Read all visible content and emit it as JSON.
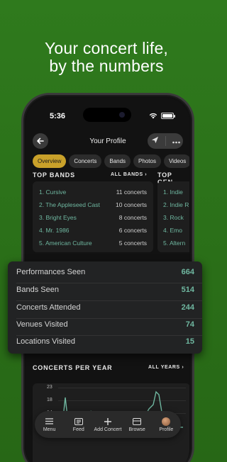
{
  "headline": {
    "line1": "Your concert life,",
    "line2": "by the numbers"
  },
  "status": {
    "time": "5:36"
  },
  "nav": {
    "title": "Your Profile"
  },
  "tabs": [
    "Overview",
    "Concerts",
    "Bands",
    "Photos",
    "Videos"
  ],
  "top_bands": {
    "title": "TOP BANDS",
    "link": "ALL BANDS",
    "items": [
      {
        "name": "1. Cursive",
        "count": "11 concerts"
      },
      {
        "name": "2. The Appleseed Cast",
        "count": "10 concerts"
      },
      {
        "name": "3. Bright Eyes",
        "count": "8 concerts"
      },
      {
        "name": "4. Mr. 1986",
        "count": "6 concerts"
      },
      {
        "name": "5. American Culture",
        "count": "5 concerts"
      }
    ]
  },
  "top_genres": {
    "title": "TOP GEN",
    "items": [
      "1. Indie",
      "2. Indie R",
      "3. Rock",
      "4. Emo",
      "5. Altern"
    ]
  },
  "stats": [
    {
      "label": "Performances Seen",
      "value": "664"
    },
    {
      "label": "Bands Seen",
      "value": "514"
    },
    {
      "label": "Concerts Attended",
      "value": "244"
    },
    {
      "label": "Venues Visited",
      "value": "74"
    },
    {
      "label": "Locations Visited",
      "value": "15"
    }
  ],
  "concerts_per_year": {
    "title": "CONCERTS PER YEAR",
    "link": "ALL YEARS",
    "y_ticks": [
      "23",
      "18",
      "14"
    ]
  },
  "tabbar": [
    {
      "label": "Menu",
      "icon": "menu-icon"
    },
    {
      "label": "Feed",
      "icon": "feed-icon"
    },
    {
      "label": "Add Concert",
      "icon": "plus-icon"
    },
    {
      "label": "Browse",
      "icon": "browse-icon"
    },
    {
      "label": "Profile",
      "icon": "avatar"
    }
  ],
  "colors": {
    "accent": "#c9a12a",
    "value": "#6fb7a0",
    "background": "#2f7a1d"
  }
}
